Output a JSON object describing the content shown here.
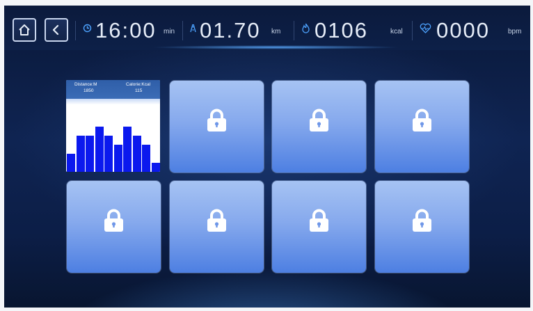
{
  "header": {
    "time": {
      "value": "16:00",
      "unit": "min",
      "icon": "clock-icon"
    },
    "distance": {
      "value": "01.70",
      "unit": "km",
      "icon": "road-icon"
    },
    "calories": {
      "value": "0106",
      "unit": "kcal",
      "icon": "flame-icon"
    },
    "heart_rate": {
      "value": "0000",
      "unit": "bpm",
      "icon": "heart-rate-icon"
    },
    "buttons": [
      {
        "name": "home-button",
        "icon": "home-icon"
      },
      {
        "name": "back-button",
        "icon": "chevron-left-icon"
      }
    ]
  },
  "program_tile": {
    "distance_label": "Distance:M",
    "distance_value": "1850",
    "calorie_label": "Calorie:Kcal",
    "calorie_value": "115",
    "bar_color": "#0b19ee",
    "profile_levels": [
      2,
      4,
      4,
      5,
      4,
      3,
      5,
      4,
      3,
      1
    ]
  },
  "locked_tiles": [
    {
      "state": "locked",
      "icon": "lock-icon"
    },
    {
      "state": "locked",
      "icon": "lock-icon"
    },
    {
      "state": "locked",
      "icon": "lock-icon"
    },
    {
      "state": "locked",
      "icon": "lock-icon"
    },
    {
      "state": "locked",
      "icon": "lock-icon"
    },
    {
      "state": "locked",
      "icon": "lock-icon"
    },
    {
      "state": "locked",
      "icon": "lock-icon"
    }
  ],
  "colors": {
    "accent": "#86a9ed",
    "background": "#0f2452",
    "text": "#e6edf8"
  }
}
